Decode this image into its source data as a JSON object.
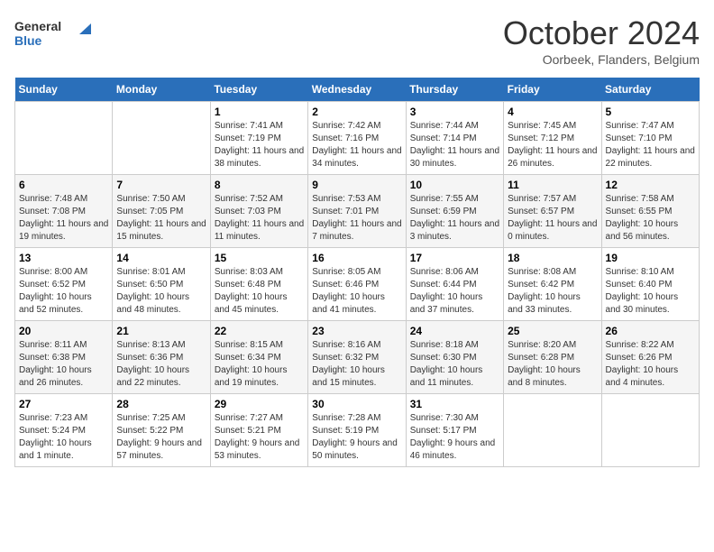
{
  "header": {
    "logo": {
      "general": "General",
      "blue": "Blue"
    },
    "title": "October 2024",
    "subtitle": "Oorbeek, Flanders, Belgium"
  },
  "days_of_week": [
    "Sunday",
    "Monday",
    "Tuesday",
    "Wednesday",
    "Thursday",
    "Friday",
    "Saturday"
  ],
  "weeks": [
    [
      {
        "day": "",
        "info": ""
      },
      {
        "day": "",
        "info": ""
      },
      {
        "day": "1",
        "info": "Sunrise: 7:41 AM\nSunset: 7:19 PM\nDaylight: 11 hours and 38 minutes."
      },
      {
        "day": "2",
        "info": "Sunrise: 7:42 AM\nSunset: 7:16 PM\nDaylight: 11 hours and 34 minutes."
      },
      {
        "day": "3",
        "info": "Sunrise: 7:44 AM\nSunset: 7:14 PM\nDaylight: 11 hours and 30 minutes."
      },
      {
        "day": "4",
        "info": "Sunrise: 7:45 AM\nSunset: 7:12 PM\nDaylight: 11 hours and 26 minutes."
      },
      {
        "day": "5",
        "info": "Sunrise: 7:47 AM\nSunset: 7:10 PM\nDaylight: 11 hours and 22 minutes."
      }
    ],
    [
      {
        "day": "6",
        "info": "Sunrise: 7:48 AM\nSunset: 7:08 PM\nDaylight: 11 hours and 19 minutes."
      },
      {
        "day": "7",
        "info": "Sunrise: 7:50 AM\nSunset: 7:05 PM\nDaylight: 11 hours and 15 minutes."
      },
      {
        "day": "8",
        "info": "Sunrise: 7:52 AM\nSunset: 7:03 PM\nDaylight: 11 hours and 11 minutes."
      },
      {
        "day": "9",
        "info": "Sunrise: 7:53 AM\nSunset: 7:01 PM\nDaylight: 11 hours and 7 minutes."
      },
      {
        "day": "10",
        "info": "Sunrise: 7:55 AM\nSunset: 6:59 PM\nDaylight: 11 hours and 3 minutes."
      },
      {
        "day": "11",
        "info": "Sunrise: 7:57 AM\nSunset: 6:57 PM\nDaylight: 11 hours and 0 minutes."
      },
      {
        "day": "12",
        "info": "Sunrise: 7:58 AM\nSunset: 6:55 PM\nDaylight: 10 hours and 56 minutes."
      }
    ],
    [
      {
        "day": "13",
        "info": "Sunrise: 8:00 AM\nSunset: 6:52 PM\nDaylight: 10 hours and 52 minutes."
      },
      {
        "day": "14",
        "info": "Sunrise: 8:01 AM\nSunset: 6:50 PM\nDaylight: 10 hours and 48 minutes."
      },
      {
        "day": "15",
        "info": "Sunrise: 8:03 AM\nSunset: 6:48 PM\nDaylight: 10 hours and 45 minutes."
      },
      {
        "day": "16",
        "info": "Sunrise: 8:05 AM\nSunset: 6:46 PM\nDaylight: 10 hours and 41 minutes."
      },
      {
        "day": "17",
        "info": "Sunrise: 8:06 AM\nSunset: 6:44 PM\nDaylight: 10 hours and 37 minutes."
      },
      {
        "day": "18",
        "info": "Sunrise: 8:08 AM\nSunset: 6:42 PM\nDaylight: 10 hours and 33 minutes."
      },
      {
        "day": "19",
        "info": "Sunrise: 8:10 AM\nSunset: 6:40 PM\nDaylight: 10 hours and 30 minutes."
      }
    ],
    [
      {
        "day": "20",
        "info": "Sunrise: 8:11 AM\nSunset: 6:38 PM\nDaylight: 10 hours and 26 minutes."
      },
      {
        "day": "21",
        "info": "Sunrise: 8:13 AM\nSunset: 6:36 PM\nDaylight: 10 hours and 22 minutes."
      },
      {
        "day": "22",
        "info": "Sunrise: 8:15 AM\nSunset: 6:34 PM\nDaylight: 10 hours and 19 minutes."
      },
      {
        "day": "23",
        "info": "Sunrise: 8:16 AM\nSunset: 6:32 PM\nDaylight: 10 hours and 15 minutes."
      },
      {
        "day": "24",
        "info": "Sunrise: 8:18 AM\nSunset: 6:30 PM\nDaylight: 10 hours and 11 minutes."
      },
      {
        "day": "25",
        "info": "Sunrise: 8:20 AM\nSunset: 6:28 PM\nDaylight: 10 hours and 8 minutes."
      },
      {
        "day": "26",
        "info": "Sunrise: 8:22 AM\nSunset: 6:26 PM\nDaylight: 10 hours and 4 minutes."
      }
    ],
    [
      {
        "day": "27",
        "info": "Sunrise: 7:23 AM\nSunset: 5:24 PM\nDaylight: 10 hours and 1 minute."
      },
      {
        "day": "28",
        "info": "Sunrise: 7:25 AM\nSunset: 5:22 PM\nDaylight: 9 hours and 57 minutes."
      },
      {
        "day": "29",
        "info": "Sunrise: 7:27 AM\nSunset: 5:21 PM\nDaylight: 9 hours and 53 minutes."
      },
      {
        "day": "30",
        "info": "Sunrise: 7:28 AM\nSunset: 5:19 PM\nDaylight: 9 hours and 50 minutes."
      },
      {
        "day": "31",
        "info": "Sunrise: 7:30 AM\nSunset: 5:17 PM\nDaylight: 9 hours and 46 minutes."
      },
      {
        "day": "",
        "info": ""
      },
      {
        "day": "",
        "info": ""
      }
    ]
  ]
}
